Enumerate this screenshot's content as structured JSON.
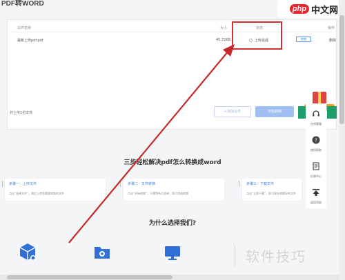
{
  "page_title": "PDF转WORD",
  "logo": {
    "mark": "php",
    "text": "中文网"
  },
  "file_table": {
    "headers": {
      "name": "文件名称",
      "size": "大小",
      "status": "状态",
      "op": "操作"
    },
    "row": {
      "name": "最新上传pdf.pdf",
      "size": "45.72KB",
      "status": "上传完成",
      "op_primary": "转换",
      "op_secondary": "删除"
    }
  },
  "footer": {
    "summary": "共上传1份文件",
    "add_button": "+添加文件",
    "start_button": "开始转换"
  },
  "sidebar": {
    "items": [
      {
        "label": "在线客服"
      },
      {
        "label": "使用帮助"
      },
      {
        "label": "反馈中心"
      },
      {
        "label": "返回顶部"
      }
    ]
  },
  "guide": {
    "title": "三步轻松解决pdf怎么转换成word",
    "steps": [
      {
        "title": "步骤一：上传文件",
        "desc": "点击“选择文件”，然后上传您需要转换的文件"
      },
      {
        "title": "步骤二：文件转换",
        "desc": "点击“开始转换”，只需等待几秒钟，即可完成转换"
      },
      {
        "title": "步骤三：下载文件",
        "desc": "点击“立即下载”，即可保存转换好的文件"
      }
    ]
  },
  "why": {
    "title": "为什么选择我们?"
  },
  "watermark": "软件技巧",
  "colors": {
    "accent": "#3a7fd8",
    "highlight": "#d32f2f",
    "green": "#1e9e6b",
    "button_disabled": "#9fc0f0"
  }
}
